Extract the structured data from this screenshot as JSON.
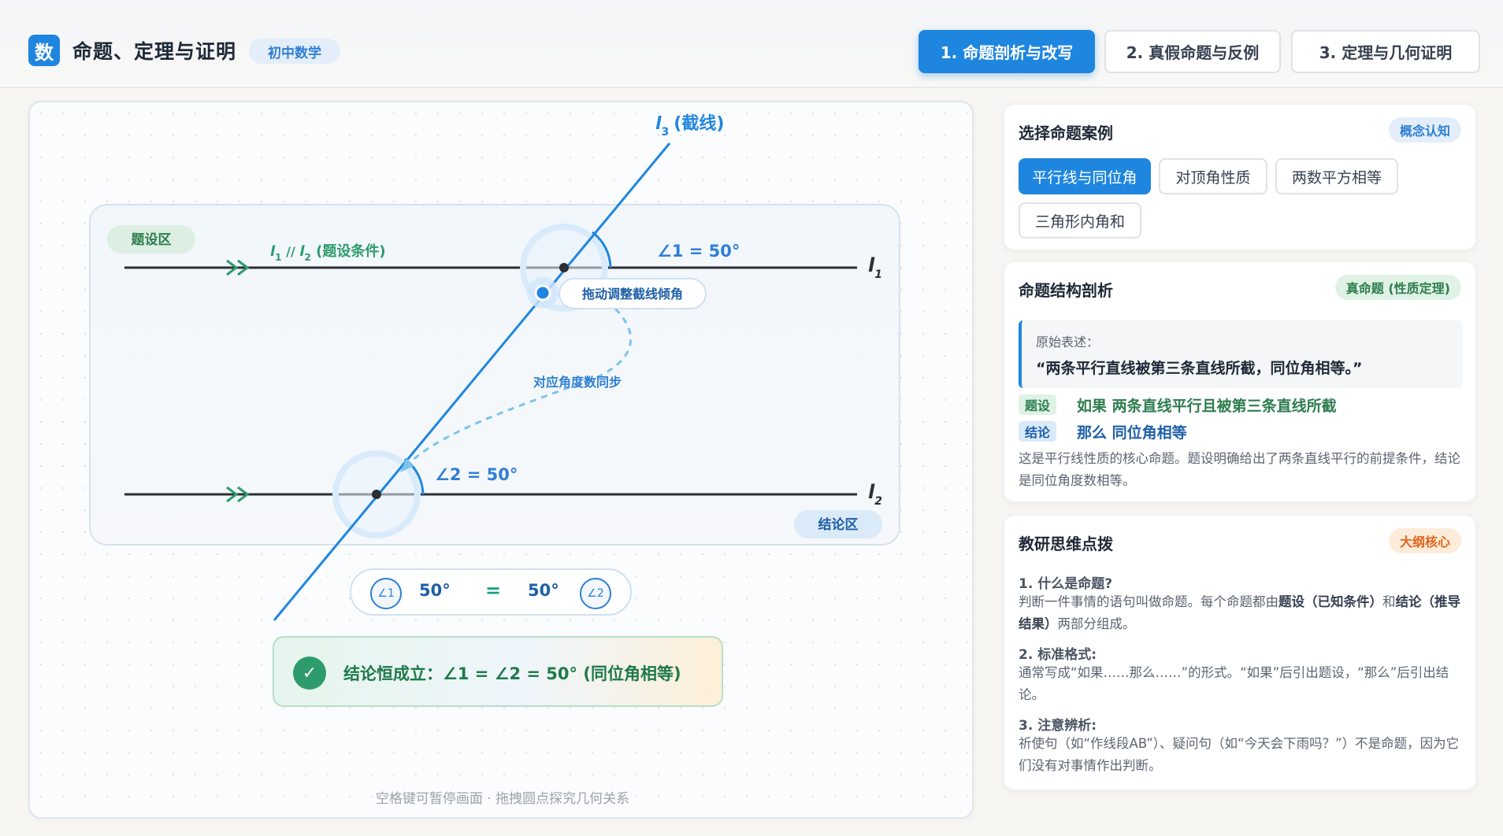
{
  "header": {
    "logo_char": "数",
    "title": "命题、定理与证明",
    "level_badge": "初中数学",
    "tabs": [
      {
        "label": "1. 命题剖析与改写",
        "active": true
      },
      {
        "label": "2. 真假命题与反例",
        "active": false
      },
      {
        "label": "3. 定理与几何证明",
        "active": false
      }
    ]
  },
  "diagram": {
    "transversal_label": "(截线)",
    "line_names": {
      "l1": "l",
      "l1_sub": "1",
      "l2": "l",
      "l2_sub": "2",
      "l3": "l",
      "l3_sub": "3"
    },
    "premise_zone_label": "题设区",
    "conclusion_zone_label": "结论区",
    "parallel_label_prefix": "l",
    "parallel_label_mid": " // ",
    "parallel_label_suffix": " (题设条件)",
    "angle1_label": "∠1 = 50°",
    "angle2_label": "∠2 = 50°",
    "drag_hint": "拖动调整截线倾角",
    "sync_label": "对应角度数同步",
    "angle_value_deg": 50,
    "colors": {
      "transversal": "#1f86e0",
      "premise": "#2e9b6c",
      "line": "#2b2f33"
    }
  },
  "compare": {
    "chip1": "∠1",
    "value1": "50°",
    "equals": "=",
    "value2": "50°",
    "chip2": "∠2"
  },
  "conclusion": {
    "check_icon": "✓",
    "text": "结论恒成立：∠1 = ∠2 = 50° (同位角相等)"
  },
  "footer_hint": "空格键可暂停画面 · 拖拽圆点探究几何关系",
  "case_panel": {
    "title": "选择命题案例",
    "badge": "概念认知",
    "cases": [
      {
        "label": "平行线与同位角",
        "active": true
      },
      {
        "label": "对顶角性质",
        "active": false
      },
      {
        "label": "两数平方相等",
        "active": false
      },
      {
        "label": "三角形内角和",
        "active": false
      }
    ]
  },
  "structure_panel": {
    "title": "命题结构剖析",
    "badge": "真命题 (性质定理)",
    "original_label": "原始表述：",
    "original_text": "“两条平行直线被第三条直线所截，同位角相等。”",
    "premise_tag": "题设",
    "premise_text": "如果 两条直线平行且被第三条直线所截",
    "conclusion_tag": "结论",
    "conclusion_text": "那么 同位角相等",
    "description": "这是平行线性质的核心命题。题设明确给出了两条直线平行的前提条件，结论是同位角度数相等。"
  },
  "tips_panel": {
    "title": "教研思维点拨",
    "badge": "大纲核心",
    "items": [
      {
        "head": "1. 什么是命题?",
        "body_a": "判断一件事情的语句叫做命题。每个命题都由",
        "bold_a": "题设（已知条件）",
        "body_b": "和",
        "bold_b": "结论（推导结果）",
        "body_c": "两部分组成。"
      },
      {
        "head": "2. 标准格式:",
        "body": "通常写成“如果……那么……”的形式。“如果”后引出题设，“那么”后引出结论。"
      },
      {
        "head": "3. 注意辨析:",
        "body": "祈使句（如“作线段AB”）、疑问句（如“今天会下雨吗？”）不是命题，因为它们没有对事情作出判断。"
      }
    ]
  }
}
